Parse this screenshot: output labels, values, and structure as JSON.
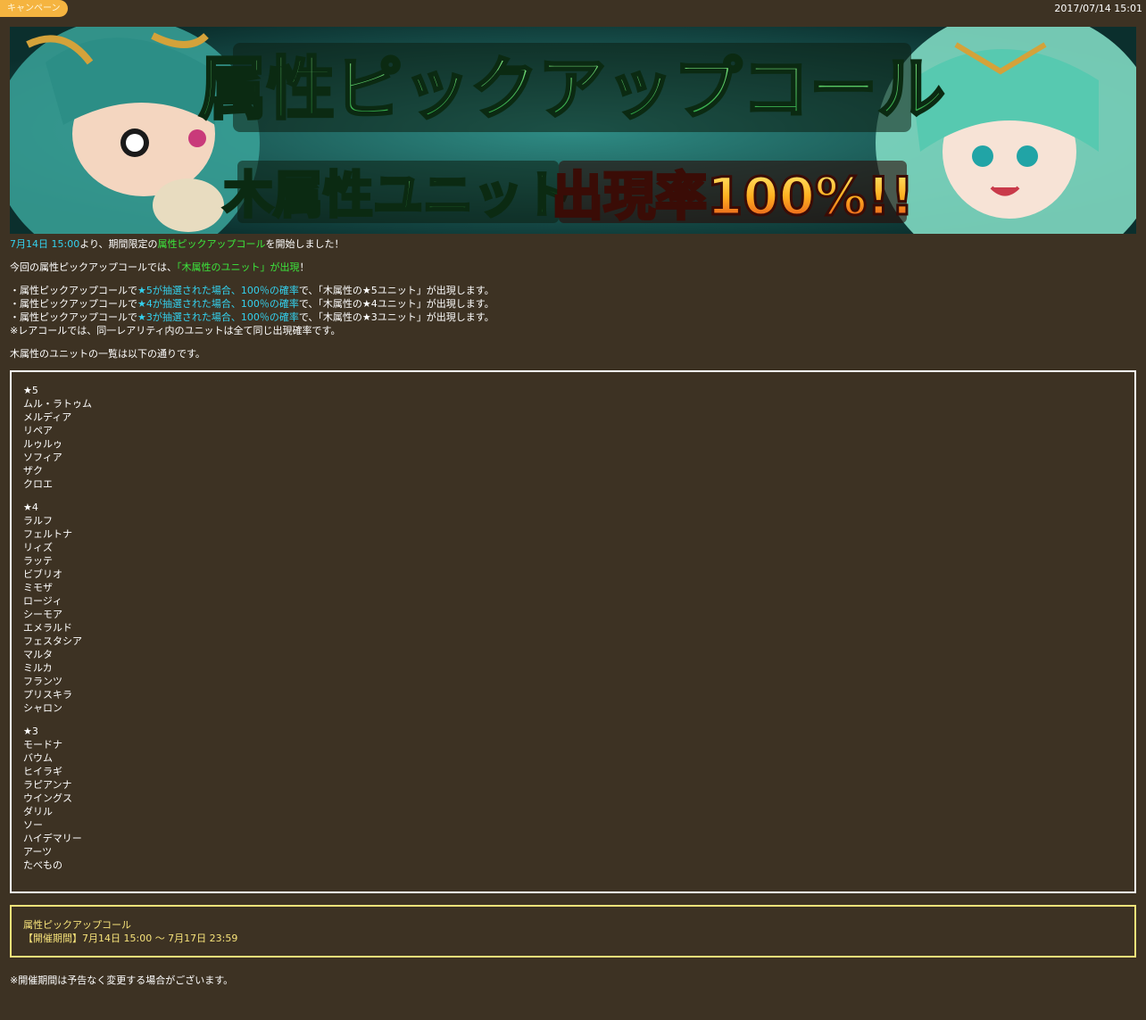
{
  "header": {
    "badge": "キャンペーン",
    "date": "2017/07/14 15:01"
  },
  "banner": {
    "title": "属性ピックアップコール",
    "subtitle_left": "木属性ユニット",
    "subtitle_right": "出現率100%!!"
  },
  "intro": {
    "date_link": "7月14日 15:00",
    "text1": "より、期間限定の",
    "call_link": "属性ピックアップコール",
    "text2": "を開始しました！"
  },
  "line2": {
    "text1": "今回の属性ピックアップコールでは、",
    "highlight": "「木属性のユニット」が出現",
    "text2": "！"
  },
  "rates": [
    {
      "prefix": "・属性ピックアップコールで",
      "highlight": "★5が抽選された場合、100％の確率",
      "suffix": "で、「木属性の★5ユニット」が出現します。"
    },
    {
      "prefix": "・属性ピックアップコールで",
      "highlight": "★4が抽選された場合、100％の確率",
      "suffix": "で、「木属性の★4ユニット」が出現します。"
    },
    {
      "prefix": "・属性ピックアップコールで",
      "highlight": "★3が抽選された場合、100％の確率",
      "suffix": "で、「木属性の★3ユニット」が出現します。"
    }
  ],
  "rare_note": "※レアコールでは、同一レアリティ内のユニットは全て同じ出現確率です。",
  "list_intro": "木属性のユニットの一覧は以下の通りです。",
  "units": {
    "tier5": {
      "label": "★5",
      "items": [
        "ムル・ラトゥム",
        "メルディア",
        "リペア",
        "ルゥルゥ",
        "ソフィア",
        "ザク",
        "クロエ"
      ]
    },
    "tier4": {
      "label": "★4",
      "items": [
        "ラルフ",
        "フェルトナ",
        "リィズ",
        "ラッテ",
        "ビブリオ",
        "ミモザ",
        "ロージィ",
        "シーモア",
        "エメラルド",
        "フェスタシア",
        "マルタ",
        "ミルカ",
        "フランツ",
        "プリスキラ",
        "シャロン"
      ]
    },
    "tier3": {
      "label": "★3",
      "items": [
        "モードナ",
        "バウム",
        "ヒイラギ",
        "ラピアンナ",
        "ウイングス",
        "ダリル",
        "ソー",
        "ハイデマリー",
        "アーツ",
        "たべもの"
      ]
    }
  },
  "period": {
    "name": "属性ピックアップコール",
    "range": "【開催期間】7月14日 15:00 ～ 7月17日 23:59"
  },
  "final_note": "※開催期間は予告なく変更する場合がございます。",
  "colors": {
    "background": "#3d3223",
    "cyan": "#33d1ee",
    "green": "#3ce83c",
    "yellow": "#f7e37a",
    "badge": "#f5b440"
  }
}
